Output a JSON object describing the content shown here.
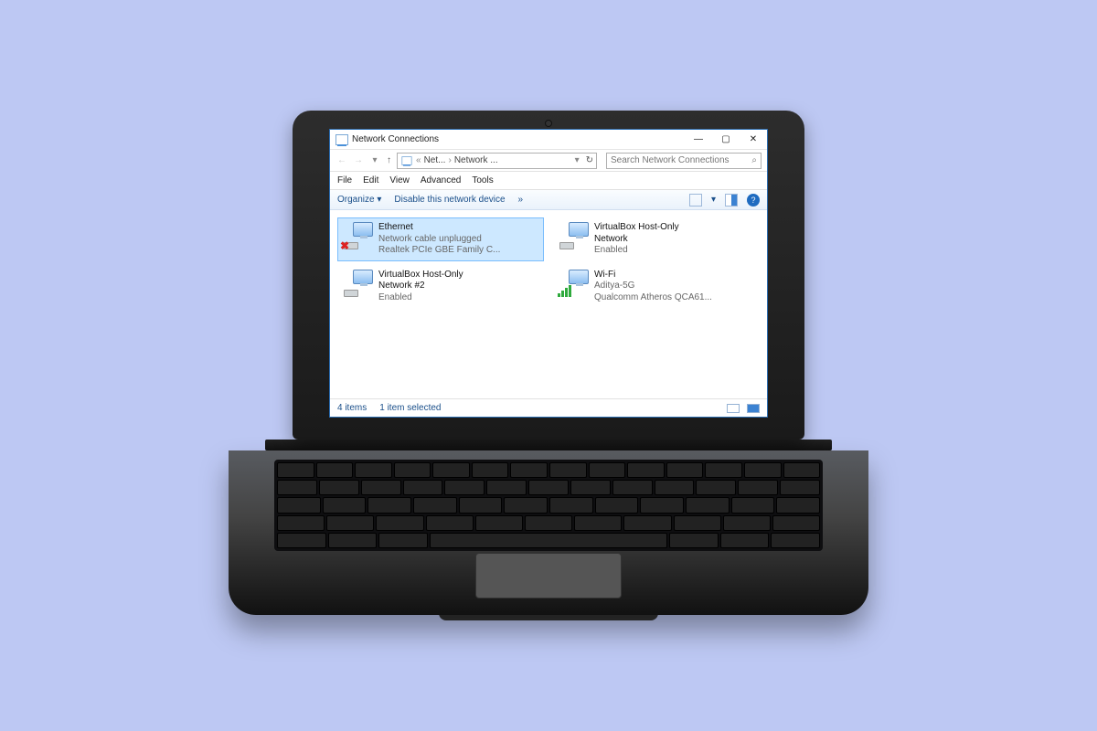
{
  "window": {
    "title": "Network Connections",
    "minimize": "—",
    "maximize": "▢",
    "close": "✕"
  },
  "nav": {
    "back": "←",
    "forward": "→",
    "up": "↑",
    "addr_prefix": "«",
    "addr_1": "Net...",
    "addr_sep": "›",
    "addr_2": "Network ...",
    "refresh": "↻",
    "search_placeholder": "Search Network Connections",
    "search_icon": "🔍"
  },
  "menus": [
    "File",
    "Edit",
    "View",
    "Advanced",
    "Tools"
  ],
  "toolbar": {
    "organize": "Organize  ▾",
    "disable": "Disable this network device",
    "more": "»",
    "help": "?"
  },
  "adapters": [
    {
      "name": "Ethernet",
      "status": "Network cable unplugged",
      "device": "Realtek PCIe GBE Family C...",
      "selected": true,
      "error": true
    },
    {
      "name": "VirtualBox Host-Only",
      "status": "Network",
      "device": "Enabled",
      "selected": false,
      "error": false
    },
    {
      "name": "VirtualBox Host-Only",
      "status": "Network #2",
      "device": "Enabled",
      "selected": false,
      "error": false
    },
    {
      "name": "Wi-Fi",
      "status": "Aditya-5G",
      "device": "Qualcomm Atheros QCA61...",
      "selected": false,
      "error": false,
      "wifi": true
    }
  ],
  "statusbar": {
    "count": "4 items",
    "selected": "1 item selected"
  }
}
